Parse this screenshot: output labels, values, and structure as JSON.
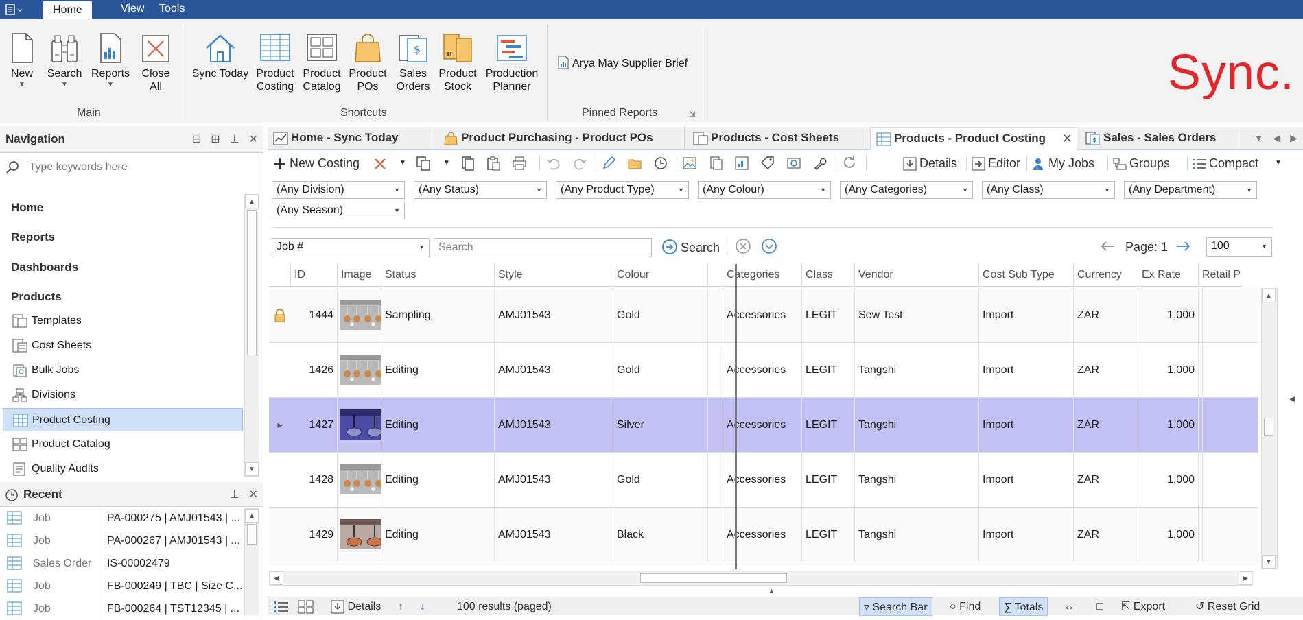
{
  "ribbon": {
    "tabs": [
      {
        "label": "Home",
        "active": true
      },
      {
        "label": "View",
        "active": false
      },
      {
        "label": "Tools",
        "active": false
      }
    ],
    "main": {
      "new": "New",
      "search": "Search",
      "reports": "Reports",
      "close_all_1": "Close",
      "close_all_2": "All",
      "group_label": "Main"
    },
    "shortcuts": {
      "sync_today": "Sync Today",
      "product_costing_1": "Product",
      "product_costing_2": "Costing",
      "product_catalog_1": "Product",
      "product_catalog_2": "Catalog",
      "product_pos_1": "Product",
      "product_pos_2": "POs",
      "sales_orders_1": "Sales",
      "sales_orders_2": "Orders",
      "product_stock_1": "Product",
      "product_stock_2": "Stock",
      "production_planner_1": "Production",
      "production_planner_2": "Planner",
      "group_label": "Shortcuts"
    },
    "pinned": {
      "report": "Arya May Supplier Brief",
      "group_label": "Pinned Reports"
    },
    "brand": "Sync.",
    "brand_color": "#e4262c"
  },
  "navigation": {
    "title": "Navigation",
    "search_placeholder": "Type keywords here",
    "groups": [
      "Home",
      "Reports",
      "Dashboards",
      "Products"
    ],
    "items": [
      {
        "label": "Templates",
        "icon": "template-icon"
      },
      {
        "label": "Cost Sheets",
        "icon": "cost-sheet-icon"
      },
      {
        "label": "Bulk Jobs",
        "icon": "bulk-jobs-icon"
      },
      {
        "label": "Divisions",
        "icon": "divisions-icon"
      },
      {
        "label": "Product Costing",
        "icon": "grid-icon",
        "selected": true
      },
      {
        "label": "Product Catalog",
        "icon": "catalog-icon"
      },
      {
        "label": "Quality Audits",
        "icon": "audit-icon"
      }
    ]
  },
  "recent": {
    "title": "Recent",
    "rows": [
      {
        "type": "Job",
        "name": "PA-000275 | AMJ01543 | ..."
      },
      {
        "type": "Job",
        "name": "PA-000267 | AMJ01543 | ..."
      },
      {
        "type": "Sales Order",
        "name": "IS-00002479"
      },
      {
        "type": "Job",
        "name": "FB-000249 | TBC | Size C..."
      },
      {
        "type": "Job",
        "name": "FB-000264 | TST12345 | ..."
      }
    ]
  },
  "doc_tabs": [
    {
      "label": "Home - Sync Today",
      "active": false
    },
    {
      "label": "Product Purchasing - Product POs",
      "active": false
    },
    {
      "label": "Products - Cost Sheets",
      "active": false
    },
    {
      "label": "Products - Product Costing",
      "active": true
    },
    {
      "label": "Sales - Sales Orders",
      "active": false
    }
  ],
  "toolbar": {
    "new_costing": "New Costing",
    "details": "Details",
    "editor": "Editor",
    "my_jobs": "My Jobs",
    "groups": "Groups",
    "compact": "Compact"
  },
  "filters": [
    "(Any Division)",
    "(Any Status)",
    "(Any Product Type)",
    "(Any Colour)",
    "(Any Categories)",
    "(Any Class)",
    "(Any Department)",
    "(Any Season)"
  ],
  "searchbar": {
    "field": "Job #",
    "placeholder": "Search",
    "search_label": "Search",
    "page_label": "Page: 1",
    "page_size": "100"
  },
  "grid": {
    "columns": [
      "ID",
      "Image",
      "Status",
      "Style",
      "Colour",
      "",
      "Categories",
      "Class",
      "Vendor",
      "Cost Sub Type",
      "Currency",
      "Ex Rate",
      "Retail P"
    ],
    "rows": [
      {
        "id": "1444",
        "status": "Sampling",
        "style": "AMJ01543",
        "colour": "Gold",
        "categories": "Accessories",
        "class": "LEGIT",
        "vendor": "Sew Test",
        "cost_sub_type": "Import",
        "currency": "ZAR",
        "ex_rate": "1,000",
        "locked": true,
        "image": "earrings-gold"
      },
      {
        "id": "1426",
        "status": "Editing",
        "style": "AMJ01543",
        "colour": "Gold",
        "categories": "Accessories",
        "class": "LEGIT",
        "vendor": "Tangshi",
        "cost_sub_type": "Import",
        "currency": "ZAR",
        "ex_rate": "1,000",
        "image": "earrings-gold"
      },
      {
        "id": "1427",
        "status": "Editing",
        "style": "AMJ01543",
        "colour": "Silver",
        "categories": "Accessories",
        "class": "LEGIT",
        "vendor": "Tangshi",
        "cost_sub_type": "Import",
        "currency": "ZAR",
        "ex_rate": "1,000",
        "selected": true,
        "image": "earrings-silver"
      },
      {
        "id": "1428",
        "status": "Editing",
        "style": "AMJ01543",
        "colour": "Gold",
        "categories": "Accessories",
        "class": "LEGIT",
        "vendor": "Tangshi",
        "cost_sub_type": "Import",
        "currency": "ZAR",
        "ex_rate": "1,000",
        "image": "earrings-gold"
      },
      {
        "id": "1429",
        "status": "Editing",
        "style": "AMJ01543",
        "colour": "Black",
        "categories": "Accessories",
        "class": "LEGIT",
        "vendor": "Tangshi",
        "cost_sub_type": "Import",
        "currency": "ZAR",
        "ex_rate": "1,000",
        "image": "earrings-black"
      }
    ],
    "selected_color": "#c1c1f4"
  },
  "statusbar": {
    "details": "Details",
    "results": "100 results (paged)",
    "search_bar": "Search Bar",
    "find": "Find",
    "totals": "Totals",
    "export": "Export",
    "reset_grid": "Reset Grid"
  }
}
